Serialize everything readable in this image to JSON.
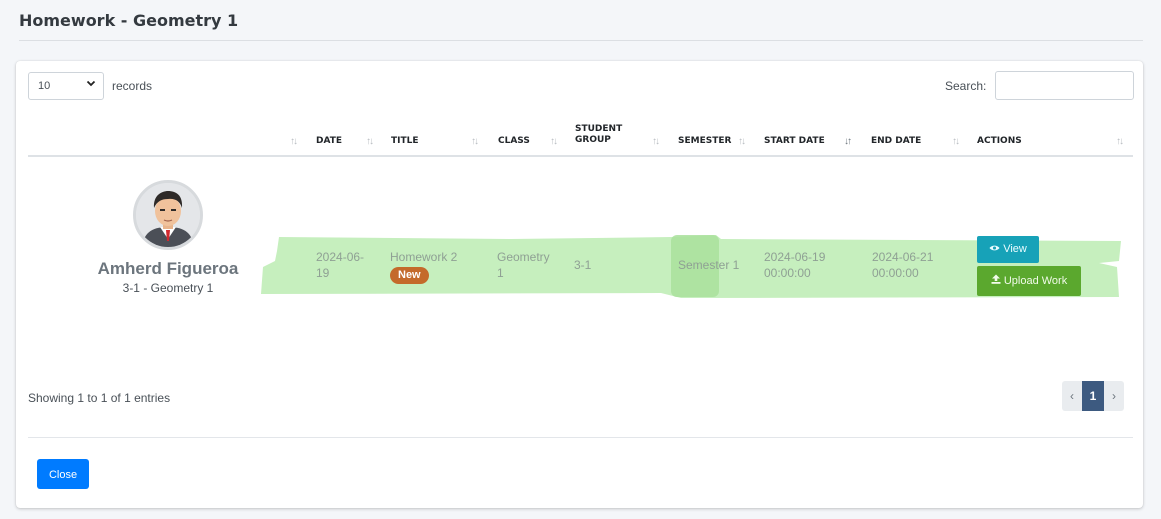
{
  "page": {
    "title": "Homework - Geometry 1"
  },
  "controls": {
    "page_length": "10",
    "records_label": "records",
    "search_label": "Search:",
    "search_value": ""
  },
  "table": {
    "columns": [
      "DATE",
      "TITLE",
      "CLASS",
      "STUDENT GROUP",
      "SEMESTER",
      "START DATE",
      "END DATE",
      "ACTIONS"
    ],
    "student": {
      "name": "Amherd Figueroa",
      "subtitle": "3-1 - Geometry 1"
    },
    "row": {
      "date_line1": "2024-06-",
      "date_line2": "19",
      "title": "Homework 2",
      "badge": "New",
      "class_line1": "Geometry",
      "class_line2": "1",
      "student_group": "3-1",
      "semester": "Semester 1",
      "start_date": "2024-06-19",
      "start_time": "00:00:00",
      "end_date": "2024-06-21",
      "end_time": "00:00:00",
      "view_label": "View",
      "upload_label": "Upload Work"
    }
  },
  "footer": {
    "entries_info": "Showing 1 to 1 of 1 entries",
    "pager_prev": "‹",
    "pager_current": "1",
    "pager_next": "›",
    "close_label": "Close"
  },
  "colors": {
    "highlight": "#c6efbe",
    "view_button": "#17a2b8",
    "upload_button": "#5ba82e",
    "close_button": "#007bff",
    "badge": "#c46a2b"
  },
  "icons": {
    "view": "eye-icon",
    "upload": "upload-icon",
    "select": "chevron-down-icon",
    "sort": "sort-icon"
  }
}
